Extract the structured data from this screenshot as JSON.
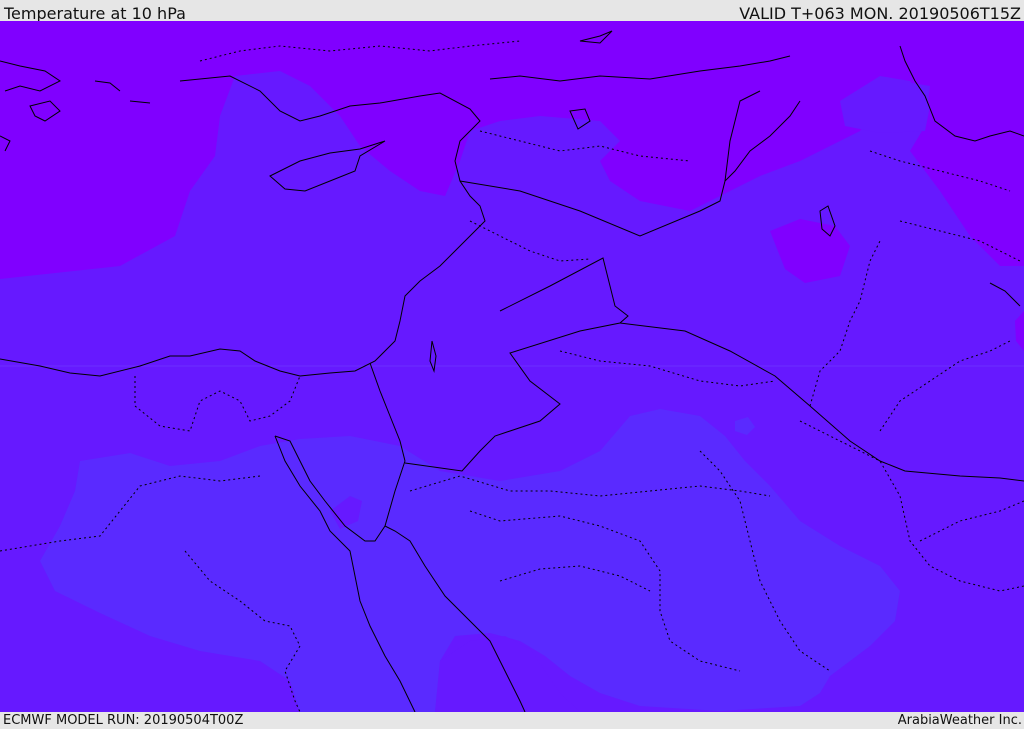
{
  "header": {
    "title": "Temperature at 10 hPa",
    "valid": "VALID T+063 MON. 20190506T15Z"
  },
  "footer": {
    "model_run": "ECMWF MODEL RUN: 20190504T00Z",
    "credit": "ArabiaWeather Inc."
  },
  "map": {
    "field": "temperature",
    "level": "10 hPa",
    "colors": {
      "band_warmest": "#8000ff",
      "band_mid": "#6619ff",
      "band_coolest": "#5a2aff",
      "coastline": "#000000",
      "borders": "#000000"
    }
  }
}
